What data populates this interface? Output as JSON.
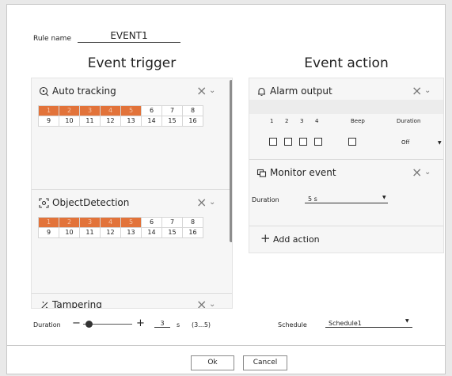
{
  "rule": {
    "label": "Rule name",
    "value": "EVENT1"
  },
  "trigger": {
    "title": "Event trigger",
    "cards": [
      {
        "title": "Auto tracking",
        "icon": "auto-tracking-icon",
        "channels": [
          "1",
          "2",
          "3",
          "4",
          "5",
          "6",
          "7",
          "8",
          "9",
          "10",
          "11",
          "12",
          "13",
          "14",
          "15",
          "16"
        ],
        "selected": [
          1,
          2,
          3,
          4,
          5
        ]
      },
      {
        "title": "ObjectDetection",
        "icon": "object-detection-icon",
        "channels": [
          "1",
          "2",
          "3",
          "4",
          "5",
          "6",
          "7",
          "8",
          "9",
          "10",
          "11",
          "12",
          "13",
          "14",
          "15",
          "16"
        ],
        "selected": [
          1,
          2,
          3,
          4,
          5
        ]
      },
      {
        "title": "Tampering",
        "icon": "tampering-icon"
      }
    ],
    "duration": {
      "label": "Duration",
      "value": "3",
      "unit": "s",
      "range": "(3...5)"
    }
  },
  "action": {
    "title": "Event action",
    "alarm": {
      "title": "Alarm output",
      "headers": [
        "1",
        "2",
        "3",
        "4",
        "Beep",
        "Duration"
      ],
      "duration_value": "Off"
    },
    "monitor": {
      "title": "Monitor event",
      "duration_label": "Duration",
      "duration_value": "5 s"
    },
    "add_action": "Add action",
    "schedule": {
      "label": "Schedule",
      "value": "Schedule1"
    }
  },
  "buttons": {
    "ok": "Ok",
    "cancel": "Cancel"
  },
  "colors": {
    "selected_channel": "#e2733a"
  }
}
